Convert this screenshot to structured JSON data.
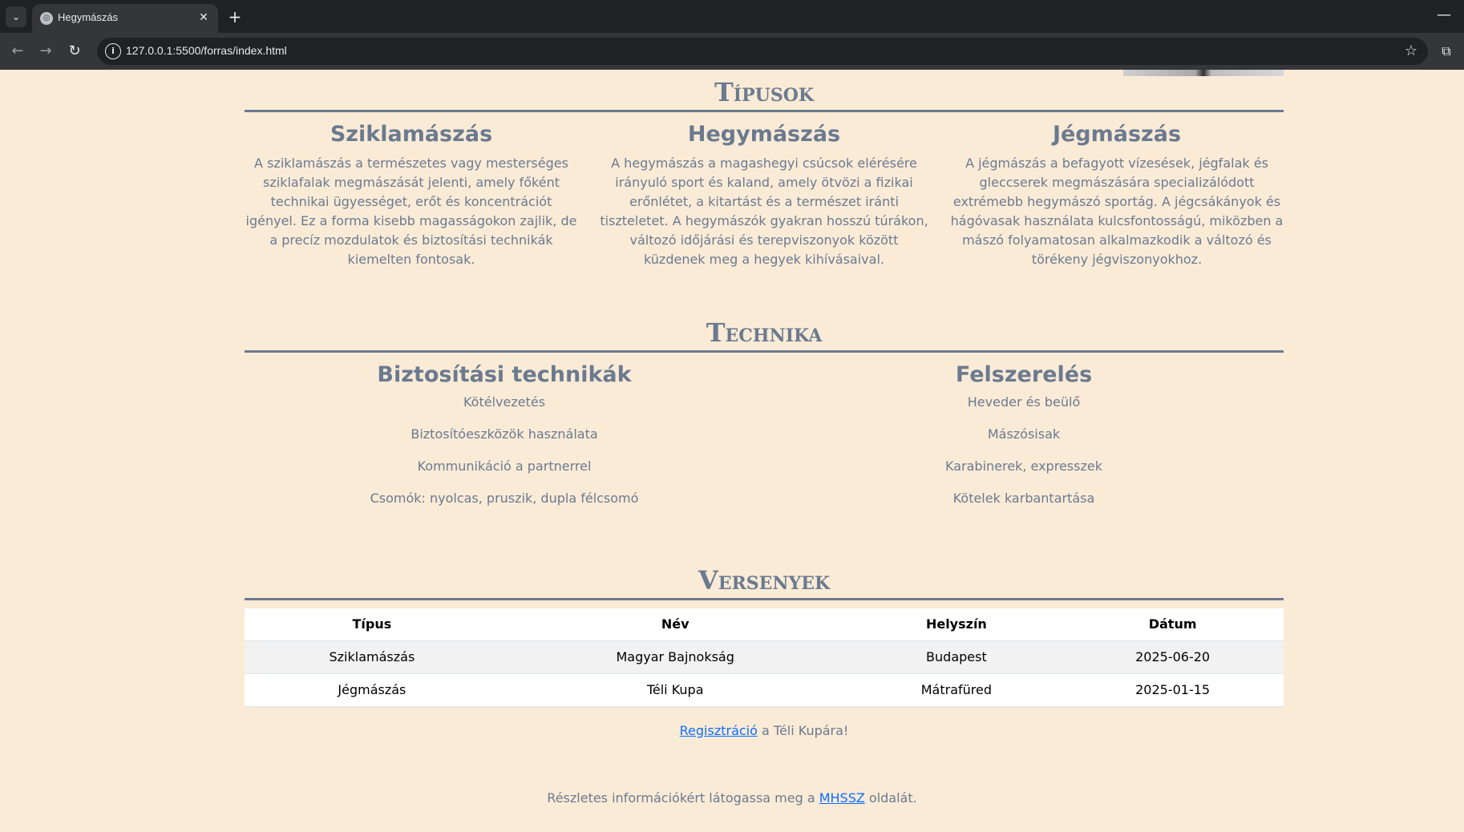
{
  "browser": {
    "tab_title": "Hegymászás",
    "url": "127.0.0.1:5500/forras/index.html"
  },
  "types": {
    "heading": "Típusok",
    "items": [
      {
        "title": "Sziklamászás",
        "text": "A sziklamászás a természetes vagy mesterséges sziklafalak megmászását jelenti, amely főként technikai ügyességet, erőt és koncentrációt igényel. Ez a forma kisebb magasságokon zajlik, de a precíz mozdulatok és biztosítási technikák kiemelten fontosak."
      },
      {
        "title": "Hegymászás",
        "text": "A hegymászás a magashegyi csúcsok elérésére irányuló sport és kaland, amely ötvözi a fizikai erőnlétet, a kitartást és a természet iránti tiszteletet. A hegymászók gyakran hosszú túrákon, változó időjárási és terepviszonyok között küzdenek meg a hegyek kihívásaival."
      },
      {
        "title": "Jégmászás",
        "text": "A jégmászás a befagyott vízesések, jégfalak és gleccserek megmászására specializálódott extrémebb hegymászó sportág. A jégcsákányok és hágóvasak használata kulcsfontosságú, miközben a mászó folyamatosan alkalmazkodik a változó és törékeny jégviszonyokhoz."
      }
    ]
  },
  "technique": {
    "heading": "Technika",
    "left": {
      "title": "Biztosítási technikák",
      "items": [
        "Kötélvezetés",
        "Biztosítóeszközök használata",
        "Kommunikáció a partnerrel",
        "Csomók: nyolcas, pruszik, dupla félcsomó"
      ]
    },
    "right": {
      "title": "Felszerelés",
      "items": [
        "Heveder és beülő",
        "Mászósisak",
        "Karabinerek, expresszek",
        "Kötelek karbantartása"
      ]
    }
  },
  "competitions": {
    "heading": "Versenyek",
    "columns": [
      "Típus",
      "Név",
      "Helyszín",
      "Dátum"
    ],
    "rows": [
      [
        "Sziklamászás",
        "Magyar Bajnokság",
        "Budapest",
        "2025-06-20"
      ],
      [
        "Jégmászás",
        "Téli Kupa",
        "Mátrafüred",
        "2025-01-15"
      ]
    ],
    "register_link": "Regisztráció",
    "register_suffix": " a Téli Kupára!"
  },
  "footer": {
    "prefix": "Részletes információkért látogassa meg a ",
    "link": "MHSSZ",
    "suffix": " oldalát."
  }
}
